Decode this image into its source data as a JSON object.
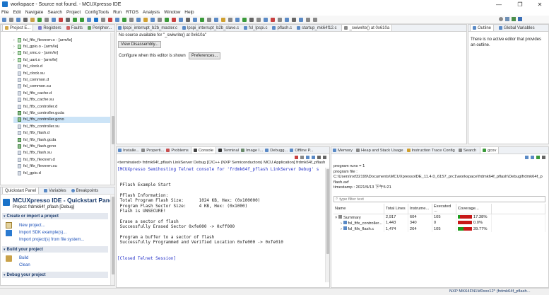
{
  "window": {
    "title": "workspace - Source not found. - MCUXpresso IDE",
    "controls": [
      "—",
      "❐",
      "✕"
    ]
  },
  "menu": [
    "File",
    "Edit",
    "Navigate",
    "Search",
    "Project",
    "ConfigTools",
    "Run",
    "RTOS",
    "Analysis",
    "Window",
    "Help"
  ],
  "project_explorer": {
    "tabs": [
      "Project E...",
      "Registers",
      "Faults",
      "Peripher..."
    ],
    "items": [
      {
        "label": "fsl_ftfx_flexnvm.o - [arm/le]",
        "kind": "o",
        "expand": true
      },
      {
        "label": "fsl_gpio.o - [arm/le]",
        "kind": "o",
        "expand": true
      },
      {
        "label": "fsl_smc.o - [arm/le]",
        "kind": "o",
        "expand": true
      },
      {
        "label": "fsl_uart.o - [arm/le]",
        "kind": "o",
        "expand": true
      },
      {
        "label": "fsl_clock.d",
        "kind": "f"
      },
      {
        "label": "fsl_clock.su",
        "kind": "f"
      },
      {
        "label": "fsl_common.d",
        "kind": "f"
      },
      {
        "label": "fsl_common.su",
        "kind": "f"
      },
      {
        "label": "fsl_ftfx_cache.d",
        "kind": "f"
      },
      {
        "label": "fsl_ftfx_cache.su",
        "kind": "f"
      },
      {
        "label": "fsl_ftfx_controller.d",
        "kind": "f"
      },
      {
        "label": "fsl_ftfx_controller.gcda",
        "kind": "g"
      },
      {
        "label": "fsl_ftfx_controller.gcno",
        "kind": "g",
        "selected": true
      },
      {
        "label": "fsl_ftfx_controller.su",
        "kind": "f"
      },
      {
        "label": "fsl_ftfx_flash.d",
        "kind": "f"
      },
      {
        "label": "fsl_ftfx_flash.gcda",
        "kind": "g"
      },
      {
        "label": "fsl_ftfx_flash.gcno",
        "kind": "g"
      },
      {
        "label": "fsl_ftfx_flash.su",
        "kind": "f"
      },
      {
        "label": "fsl_ftfx_flexnvm.d",
        "kind": "f"
      },
      {
        "label": "fsl_ftfx_flexnvm.su",
        "kind": "f"
      },
      {
        "label": "fsl_gpio.d",
        "kind": "f"
      }
    ]
  },
  "quickstart": {
    "tabs": [
      "Quickstart Panel",
      "Variables",
      "Breakpoints"
    ],
    "title": "MCUXpresso IDE - Quickstart Panel",
    "project": "Project: frdmk64f_pflash [Debug]",
    "sections": [
      {
        "label": "Create or import a project",
        "links": [
          "New project...",
          "Import SDK example(s)...",
          "Import project(s) from file system..."
        ]
      },
      {
        "label": "Build your project",
        "links": [
          "Build",
          "Clean"
        ]
      },
      {
        "label": "Debug your project",
        "links": []
      }
    ]
  },
  "editor": {
    "tabs": [
      "lpspi_interrupt_b2b_master.c",
      "lpspi_interrupt_b2b_slave.c",
      "fsl_lpspi.c",
      "pflash.c",
      "startup_mk64f12.c",
      "_swiwrite() at 0x610a"
    ],
    "message": "No source available for \"_swiwrite() at 0x610a\"",
    "view_disassembly": "View Disassembly...",
    "configure_text": "Configure when this editor is shown",
    "preferences": "Preferences..."
  },
  "outline": {
    "tabs": [
      "Outline",
      "Global Variables"
    ],
    "message": "There is no active editor that provides an outline."
  },
  "console": {
    "tabs": [
      "Installe...",
      "Properti...",
      "Problems",
      "Console",
      "Terminal",
      "Image I...",
      "Debugg...",
      "Offline P..."
    ],
    "header": "<terminated> frdmk64f_pflash LinkServer Debug [C/C++ (NXP Semiconductors) MCU Application] frdmk64f_pflash",
    "lines": [
      {
        "text": "[MCUXpresso Semihosting Telnet console for 'frdmk64f_pflash LinkServer Debug' s",
        "blue": true
      },
      {
        "text": "",
        "blue": false
      },
      {
        "text": "",
        "blue": false
      },
      {
        "text": " PFlash Example Start",
        "blue": false
      },
      {
        "text": "",
        "blue": false
      },
      {
        "text": " PFlash Information:",
        "blue": false
      },
      {
        "text": " Total Program Flash Size:      1024 KB, Hex: (0x100000)",
        "blue": false
      },
      {
        "text": " Program Flash Sector Size:     4 KB, Hex: (0x1000)",
        "blue": false
      },
      {
        "text": " Flash is UNSECURE!",
        "blue": false
      },
      {
        "text": "",
        "blue": false
      },
      {
        "text": " Erase a sector of flash",
        "blue": false
      },
      {
        "text": " Successfully Erased Sector 0xfe000 -> 0xff000",
        "blue": false
      },
      {
        "text": "",
        "blue": false
      },
      {
        "text": " Program a buffer to a sector of flash",
        "blue": false
      },
      {
        "text": " Successfully Programmed and Verified Location 0xfe000 -> 0xfe010",
        "blue": false
      },
      {
        "text": "",
        "blue": false
      },
      {
        "text": "",
        "blue": false
      },
      {
        "text": "[Closed Telnet Session]",
        "blue": true
      }
    ]
  },
  "gcov": {
    "tabs": [
      "Memory",
      "Heap and Stack Usage",
      "Instruction Trace Config",
      "Search",
      "gcov"
    ],
    "info": [
      "program runs = 1",
      "program file :",
      "C:\\Users\\nxf32199\\Documents\\MCUXpressoIDE_11.4.0_6157_prc1\\workspace\\frdmk64f_pflash\\Debug\\frdmk64f_p",
      "flash.axf",
      "timestamp : 2021/9/13 下午5:21"
    ],
    "filter_placeholder": "type filter text",
    "columns": [
      "Name",
      "Total Lines",
      "Instrume...",
      "Executed ...",
      "Coverage..."
    ],
    "rows": [
      {
        "name": "Summary",
        "total": "2,917",
        "instr": "604",
        "exec": "105",
        "coverage": "17.38%",
        "pct": 17.38,
        "level": 0,
        "expand": "v"
      },
      {
        "name": "fsl_ftfx_controller...",
        "total": "1,443",
        "instr": "340",
        "exec": "0",
        "coverage": "0.0%",
        "pct": 0.0,
        "level": 1,
        "expand": ">"
      },
      {
        "name": "fsl_ftfx_flash.c",
        "total": "1,474",
        "instr": "264",
        "exec": "105",
        "coverage": "39.77%",
        "pct": 39.77,
        "level": 1,
        "expand": ">"
      }
    ]
  },
  "status_bar": {
    "text": "NXP MK64FN1M0xxx12* (frdmk64f_pflash..."
  },
  "colors": {
    "accent": "#1a73c9",
    "console_blue": "#2430c8",
    "cov_green": "#1c9c1c",
    "cov_red": "#c81818"
  }
}
